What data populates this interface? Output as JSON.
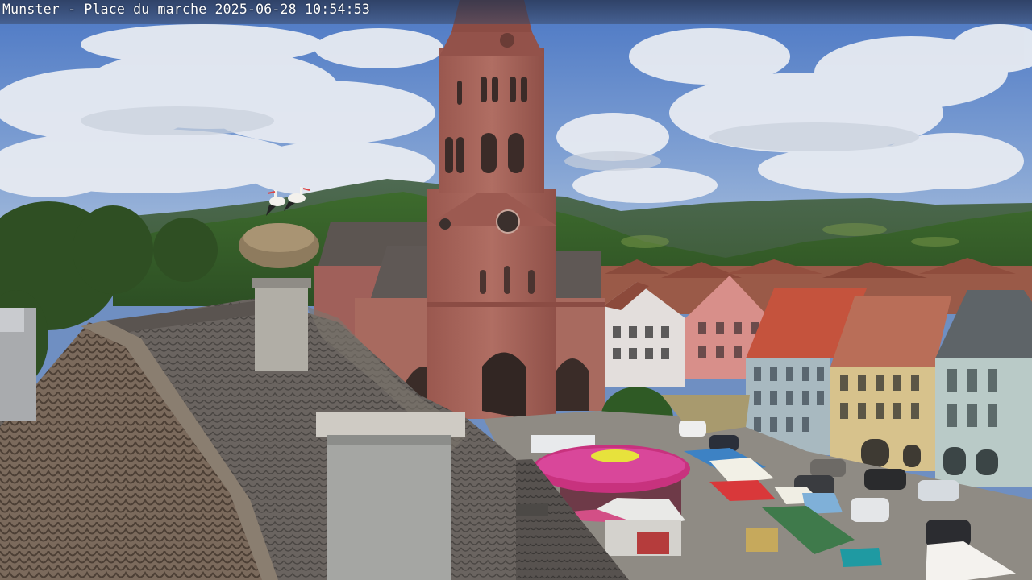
{
  "overlay": {
    "caption": "Munster - Place du marche 2025-06-28 10:54:53"
  },
  "scene": {
    "colors": {
      "sky": "#5f86c9",
      "cloud": "#e9edf4",
      "hills": "#3f5e2c",
      "church": "#a7635a",
      "roof_tiles": "#5e5a57",
      "market_umbrella": "#c8327e"
    }
  }
}
